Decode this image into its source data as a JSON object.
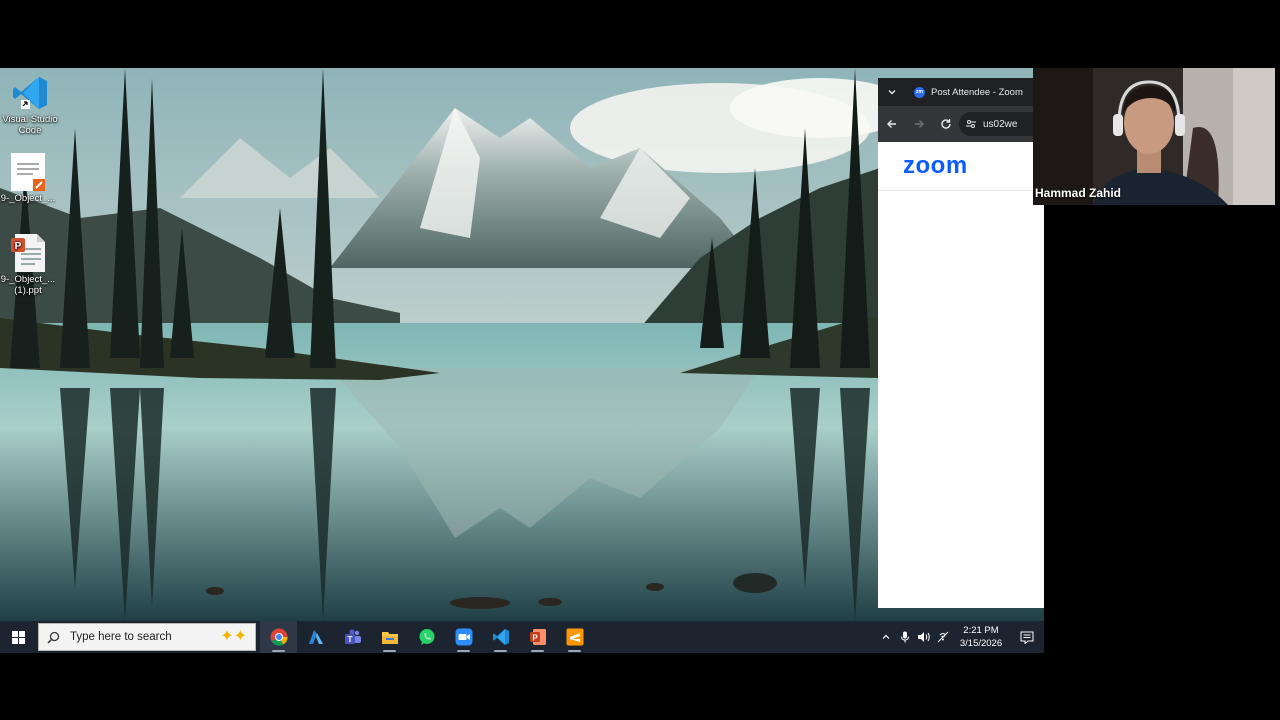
{
  "desktop": {
    "icons": [
      {
        "name": "vscode",
        "label": "Visual Studio\nCode"
      },
      {
        "name": "ppt-file-1",
        "label": "9-_Object_..."
      },
      {
        "name": "ppt-file-2",
        "label": "9-_Object_...\n(1).ppt"
      }
    ]
  },
  "browser": {
    "tab_title": "Post Attendee - Zoom",
    "favicon_text": "zm",
    "url": "us02we",
    "logo": "zoom",
    "accent": "#0b5cff"
  },
  "webcam": {
    "participant_name": "Hammad Zahid"
  },
  "taskbar": {
    "search_placeholder": "Type here to search",
    "apps": [
      "chrome",
      "azure",
      "teams",
      "file-explorer",
      "whatsapp",
      "zoom",
      "vscode",
      "powerpoint",
      "sublime"
    ],
    "clock_time": "2:21 PM",
    "clock_date": "3/15/2026"
  }
}
